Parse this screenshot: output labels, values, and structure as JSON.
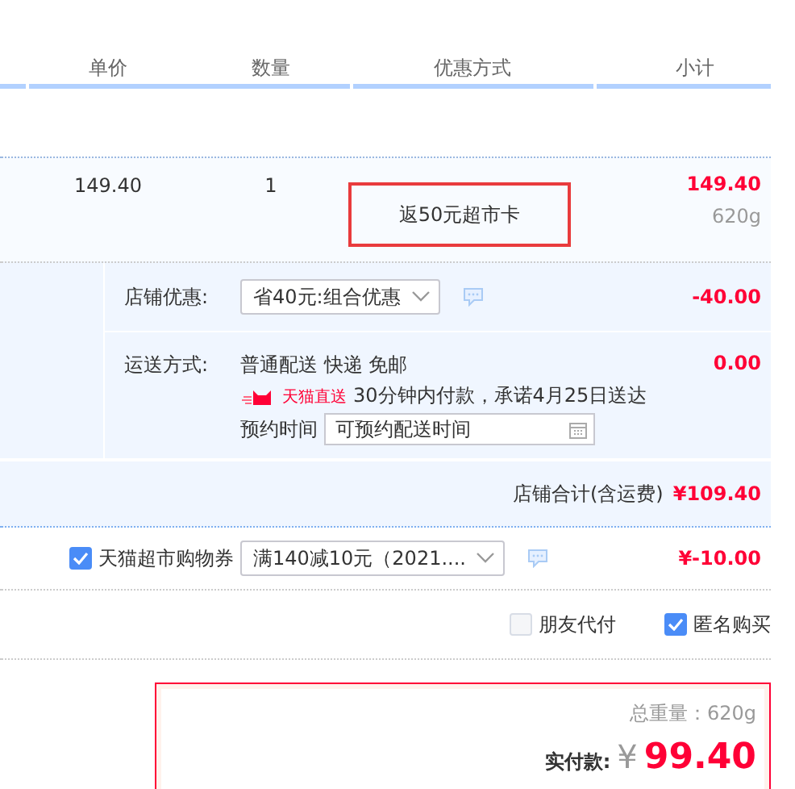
{
  "table": {
    "columns": [
      {
        "label": "单价"
      },
      {
        "label": "数量"
      },
      {
        "label": "优惠方式"
      },
      {
        "label": "小计"
      }
    ]
  },
  "item": {
    "unit_price": "149.40",
    "quantity": "1",
    "promotion": "返50元超市卡",
    "subtotal": "149.40",
    "weight": "620g"
  },
  "shop_discount": {
    "label": "店铺优惠:",
    "value": "省40元:组合优惠",
    "amount": "-40.00"
  },
  "shipping": {
    "label": "运送方式:",
    "methods": "普通配送 快递 免邮",
    "badge": "天猫直送",
    "promise": "30分钟内付款，承诺4月25日送达",
    "schedule_label": "预约时间",
    "schedule_value": "可预约配送时间",
    "amount": "0.00"
  },
  "shop_total": {
    "label": "店铺合计(含运费)",
    "amount": "¥109.40"
  },
  "coupon": {
    "checked": true,
    "label": "天猫超市购物券",
    "value": "满140减10元（2021....",
    "amount": "¥-10.00"
  },
  "options": [
    {
      "label": "朋友代付",
      "checked": false
    },
    {
      "label": "匿名购买",
      "checked": true
    }
  ],
  "summary": {
    "weight": "总重量：620g",
    "pay_label": "实付款:",
    "currency": "¥",
    "total": "99.40"
  }
}
